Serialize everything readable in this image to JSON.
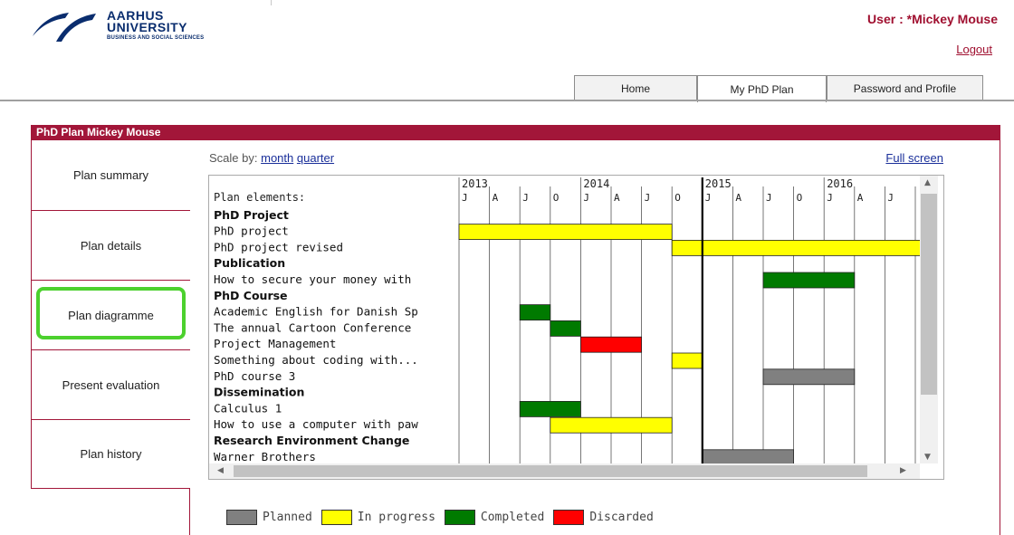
{
  "header": {
    "logo": {
      "line1": "AARHUS",
      "line2": "UNIVERSITY",
      "line3": "BUSINESS AND SOCIAL SCIENCES"
    },
    "user_label": "User : *Mickey Mouse",
    "logout": "Logout",
    "tabs": [
      {
        "label": "Home",
        "active": false
      },
      {
        "label": "My PhD Plan",
        "active": true
      },
      {
        "label": "Password and Profile",
        "active": false
      }
    ]
  },
  "panel": {
    "title": "PhD Plan Mickey Mouse",
    "sidebar": [
      {
        "label": "Plan summary"
      },
      {
        "label": "Plan details"
      },
      {
        "label": "Plan diagramme",
        "highlighted": true
      },
      {
        "label": "Present evaluation"
      },
      {
        "label": "Plan history"
      }
    ],
    "scale_by_label": "Scale by:",
    "scale_month": "month",
    "scale_quarter": "quarter",
    "full_screen": "Full screen"
  },
  "gantt": {
    "header_label": "Plan elements:",
    "years": [
      "2013",
      "2014",
      "2015",
      "2016"
    ],
    "quarter_labels": [
      "J",
      "A",
      "J",
      "O",
      "J",
      "A",
      "J",
      "O",
      "J",
      "A",
      "J",
      "O",
      "J",
      "A",
      "J"
    ],
    "current_marker_quarter": 8,
    "rows": [
      {
        "label": "PhD Project",
        "bold": true
      },
      {
        "label": "PhD project",
        "bars": [
          {
            "start": 0,
            "end": 7,
            "status": "in_progress"
          }
        ]
      },
      {
        "label": " PhD project revised",
        "bars": [
          {
            "start": 7,
            "end": 15.2,
            "status": "in_progress"
          }
        ]
      },
      {
        "label": "Publication",
        "bold": true
      },
      {
        "label": "How to secure your money with",
        "bars": [
          {
            "start": 10,
            "end": 13,
            "status": "completed"
          }
        ]
      },
      {
        "label": "PhD Course",
        "bold": true
      },
      {
        "label": "Academic English for Danish Sp",
        "bars": [
          {
            "start": 2,
            "end": 3,
            "status": "completed"
          }
        ]
      },
      {
        "label": "The annual Cartoon Conference",
        "bars": [
          {
            "start": 3,
            "end": 4,
            "status": "completed"
          }
        ]
      },
      {
        "label": "Project Management",
        "bars": [
          {
            "start": 4,
            "end": 6,
            "status": "discarded"
          }
        ]
      },
      {
        "label": "Something about coding with...",
        "bars": [
          {
            "start": 7,
            "end": 8,
            "status": "in_progress"
          }
        ]
      },
      {
        "label": "PhD course 3",
        "bars": [
          {
            "start": 10,
            "end": 13,
            "status": "planned"
          }
        ]
      },
      {
        "label": "Dissemination",
        "bold": true
      },
      {
        "label": " Calculus 1",
        "bars": [
          {
            "start": 2,
            "end": 4,
            "status": "completed"
          }
        ]
      },
      {
        "label": "How to use a computer with paw",
        "bars": [
          {
            "start": 3,
            "end": 7,
            "status": "in_progress"
          }
        ]
      },
      {
        "label": "Research Environment Change",
        "bold": true
      },
      {
        "label": "Warner Brothers",
        "bars": [
          {
            "start": 8,
            "end": 11,
            "status": "planned"
          }
        ]
      }
    ]
  },
  "legend": [
    {
      "label": "Planned",
      "color": "#808080",
      "key": "planned"
    },
    {
      "label": "In progress",
      "color": "#ffff00",
      "key": "in_progress"
    },
    {
      "label": "Completed",
      "color": "#007a00",
      "key": "completed"
    },
    {
      "label": "Discarded",
      "color": "#ff0000",
      "key": "discarded"
    }
  ],
  "colors": {
    "brand": "#a21639",
    "link": "#1a2f9a",
    "highlight": "#4cd12e"
  }
}
